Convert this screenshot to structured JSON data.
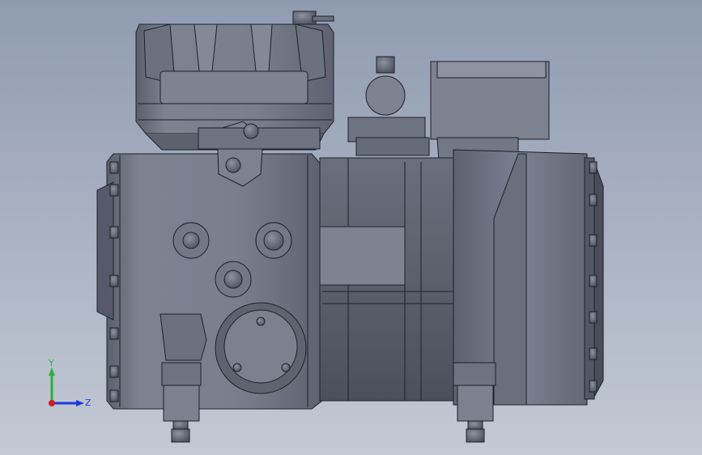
{
  "viewport": {
    "background_top": "#8f9bb0",
    "background_bottom": "#c3c9d4",
    "model_color": "#7a7f8e",
    "edge_color": "#1e2028"
  },
  "triad": {
    "x_axis_label": "",
    "y_axis_label": "Y",
    "z_axis_label": "Z",
    "y_color": "#2db03c",
    "z_color": "#1d3ad8",
    "x_color": "#d11c1c"
  }
}
